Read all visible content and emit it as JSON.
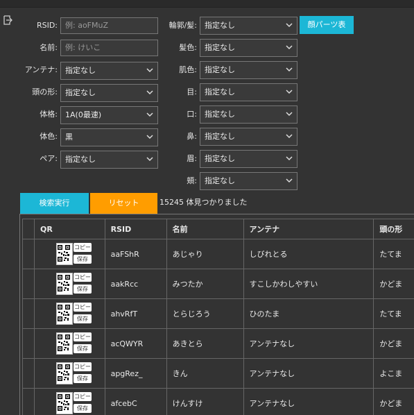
{
  "form": {
    "rsid_label": "RSID:",
    "rsid_placeholder": "例: aoFMuZ",
    "name_label": "名前:",
    "name_placeholder": "例: けいこ",
    "antenna_label": "アンテナ:",
    "antenna_value": "指定なし",
    "head_label": "頭の形:",
    "head_value": "指定なし",
    "body_label": "体格:",
    "body_value": "1A(0最速)",
    "bodycolor_label": "体色:",
    "bodycolor_value": "黒",
    "pair_label": "ペア:",
    "pair_value": "指定なし",
    "outline_label": "輪郭/髪:",
    "outline_value": "指定なし",
    "haircolor_label": "髪色:",
    "haircolor_value": "指定なし",
    "skin_label": "肌色:",
    "skin_value": "指定なし",
    "eye_label": "目:",
    "eye_value": "指定なし",
    "mouth_label": "口:",
    "mouth_value": "指定なし",
    "nose_label": "鼻:",
    "nose_value": "指定なし",
    "brow_label": "眉:",
    "brow_value": "指定なし",
    "cheek_label": "頬:",
    "cheek_value": "指定なし"
  },
  "buttons": {
    "face_parts": "顔パーツ表",
    "search": "検索実行",
    "reset": "リセット"
  },
  "result_count": "15245 体見つかりました",
  "table": {
    "headers": [
      "QR",
      "RSID",
      "名前",
      "アンテナ",
      "頭の形"
    ],
    "copy_label": "コピー",
    "save_label": "保存",
    "rows": [
      {
        "rsid": "aaFShR",
        "name": "あじゃり",
        "antenna": "しびれとる",
        "head": "たてま"
      },
      {
        "rsid": "aakRcc",
        "name": "みつたか",
        "antenna": "すこしかわしやすい",
        "head": "かどま"
      },
      {
        "rsid": "ahvRfT",
        "name": "とらじろう",
        "antenna": "ひのたま",
        "head": "たてま"
      },
      {
        "rsid": "acQWYR",
        "name": "あきとら",
        "antenna": "アンテナなし",
        "head": "かどま"
      },
      {
        "rsid": "apgRez_",
        "name": "きん",
        "antenna": "アンテナなし",
        "head": "よこま"
      },
      {
        "rsid": "afcebC",
        "name": "けんすけ",
        "antenna": "アンテナなし",
        "head": "かどま"
      }
    ]
  },
  "colors": {
    "accent_cyan": "#1cb7d6",
    "accent_orange": "#ff9d00",
    "background": "#333333"
  },
  "icons": {
    "side": "sign-in-icon",
    "dropdown": "chevron-down-icon",
    "qr": "qr-code-icon"
  }
}
